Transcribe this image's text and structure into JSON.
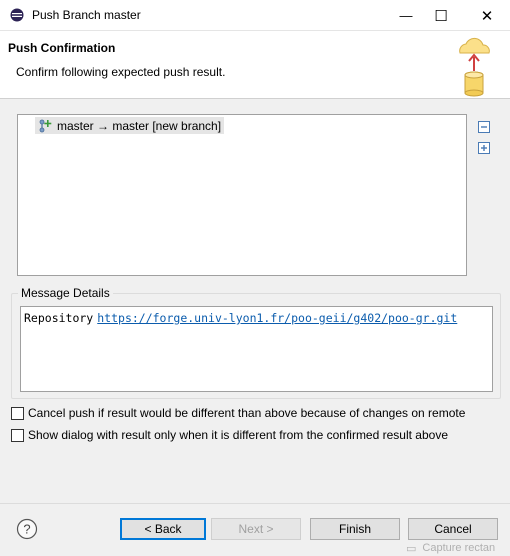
{
  "window": {
    "title": "Push Branch master",
    "controls": {
      "minimize": "—",
      "maximize": "☐",
      "close": "✕"
    }
  },
  "header": {
    "title": "Push Confirmation",
    "description": "Confirm following expected push result."
  },
  "results": {
    "items": [
      {
        "label": "master → master [new branch]"
      }
    ]
  },
  "message_details": {
    "label": "Message Details",
    "repo_label": "Repository",
    "repo_url": "https://forge.univ-lyon1.fr/poo-geii/g402/poo-gr.git"
  },
  "options": [
    {
      "label": "Cancel push if result would be different than above because of changes on remote",
      "checked": false
    },
    {
      "label": "Show dialog with result only when it is different from the confirmed result above",
      "checked": false
    }
  ],
  "buttons": {
    "back": "< Back",
    "next": "Next >",
    "finish": "Finish",
    "cancel": "Cancel"
  },
  "help_icon": "?",
  "taskbar_ghost": "Capture rectan"
}
